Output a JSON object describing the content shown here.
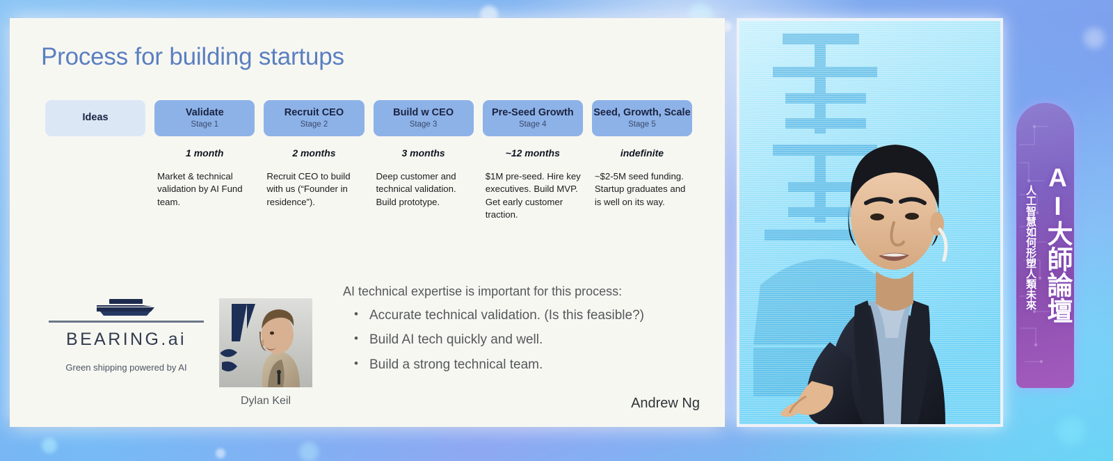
{
  "background": {
    "gradient_from": "#8cc6f5",
    "gradient_to": "#63c8f0"
  },
  "slide": {
    "title": "Process for building startups",
    "signature": "Andrew Ng",
    "title_color": "#5a7fc0",
    "background_color": "#f7f7f2",
    "stages": [
      {
        "name": "Ideas",
        "stage_label": "",
        "duration": "",
        "description": "",
        "fill": "#dce7f6"
      },
      {
        "name": "Validate",
        "stage_label": "Stage 1",
        "duration": "1 month",
        "description": "Market & technical validation by AI Fund team.",
        "fill": "#8db2e8"
      },
      {
        "name": "Recruit CEO",
        "stage_label": "Stage 2",
        "duration": "2 months",
        "description": "Recruit CEO to build with us (“Founder in residence”).",
        "fill": "#8db2e8"
      },
      {
        "name": "Build w CEO",
        "stage_label": "Stage 3",
        "duration": "3 months",
        "description": "Deep customer and technical validation. Build prototype.",
        "fill": "#8db2e8"
      },
      {
        "name": "Pre-Seed Growth",
        "stage_label": "Stage 4",
        "duration": "~12 months",
        "description": "$1M pre-seed. Hire key executives. Build MVP. Get early customer traction.",
        "fill": "#8db2e8"
      },
      {
        "name": "Seed, Growth, Scale",
        "stage_label": "Stage 5",
        "duration": "indefinite",
        "description": "~$2-5M seed funding. Startup graduates and is well on its way.",
        "fill": "#8db2e8"
      }
    ],
    "logo": {
      "wordmark": "BEARING.ai",
      "tagline": "Green shipping powered by AI",
      "icon": "ship-icon"
    },
    "portrait": {
      "caption": "Dylan Keil"
    },
    "callout": {
      "lead": "AI technical expertise is important for this process:",
      "bullet_char": "•",
      "bullets": [
        "Accurate technical validation. (Is this feasible?)",
        "Build AI tech quickly and well.",
        "Build a strong technical team."
      ]
    }
  },
  "video": {
    "speaker_alt": "speaker-on-stage",
    "screen_alt": "led-screen-background"
  },
  "banner": {
    "main_text": "AI大師論壇",
    "sub_text": "人工智慧如何形塑人類未來",
    "color_from": "#8e7ed0",
    "color_to": "#a35bbd"
  }
}
